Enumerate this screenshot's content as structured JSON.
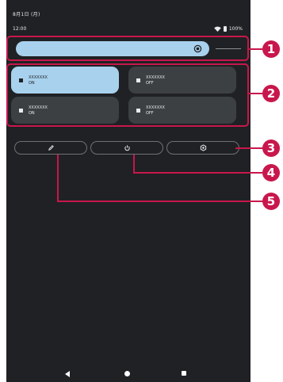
{
  "status_bar": {
    "date": "8月1日 (月)",
    "time": "12:00",
    "battery": "100%",
    "wifi_icon": "wifi-icon",
    "battery_icon": "battery-icon"
  },
  "brightness": {
    "level": 0.85,
    "icon": "brightness-icon"
  },
  "tiles": [
    {
      "name": "XXXXXXX",
      "state": "ON"
    },
    {
      "name": "XXXXXXX",
      "state": "OFF"
    },
    {
      "name": "XXXXXXX",
      "state": "ON"
    },
    {
      "name": "XXXXXXX",
      "state": "OFF"
    }
  ],
  "actions": {
    "edit_icon": "pencil-icon",
    "power_icon": "power-icon",
    "settings_icon": "gear-icon"
  },
  "callouts": [
    "1",
    "2",
    "3",
    "4",
    "5"
  ],
  "nav": {
    "back_icon": "back-icon",
    "home_icon": "home-icon",
    "recents_icon": "recents-icon"
  },
  "colors": {
    "panel_bg": "#202124",
    "tile_on": "#a8d1ee",
    "tile_off": "#3c4043",
    "callout": "#c8174c"
  }
}
